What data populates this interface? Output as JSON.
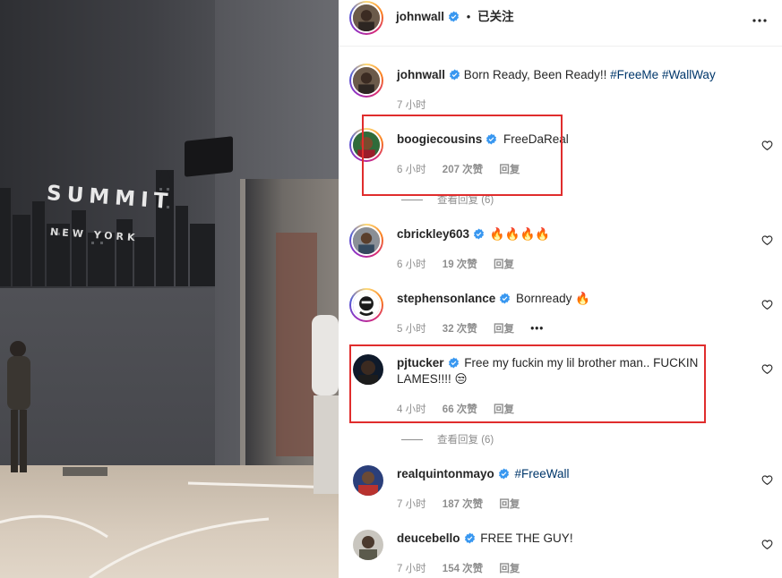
{
  "post": {
    "author": "johnwall",
    "follow_status": "已关注",
    "separator": "•",
    "icons": {
      "verified": "verified-badge-icon",
      "more": "more-options-icon",
      "like": "heart-icon"
    },
    "caption": {
      "username": "johnwall",
      "text": "Born Ready, Been Ready!!",
      "hashtags": [
        "#FreeMe",
        "#WallWay"
      ],
      "time": "7 小时"
    }
  },
  "media": {
    "sign_text": "SUMMIT",
    "sign_subtext": "NEW YORK"
  },
  "comments": [
    {
      "username": "boogiecousins",
      "text": "FreeDaReal",
      "time": "6 小时",
      "likes": "207 次赞",
      "reply": "回复",
      "view_replies": "查看回复 (6)"
    },
    {
      "username": "cbrickley603",
      "text": "🔥🔥🔥🔥",
      "time": "6 小时",
      "likes": "19 次赞",
      "reply": "回复"
    },
    {
      "username": "stephensonlance",
      "text": "Bornready 🔥",
      "time": "5 小时",
      "likes": "32 次赞",
      "reply": "回复",
      "more": "•••"
    },
    {
      "username": "pjtucker",
      "text": "Free my fuckin my lil brother man.. FUCKIN LAMES!!!! 😒",
      "time": "4 小时",
      "likes": "66 次赞",
      "reply": "回复",
      "view_replies": "查看回复 (6)"
    },
    {
      "username": "realquintonmayo",
      "text": "#FreeWall",
      "time": "7 小时",
      "likes": "187 次赞",
      "reply": "回复"
    },
    {
      "username": "deucebello",
      "text": "FREE THE GUY!",
      "time": "7 小时",
      "likes": "154 次赞",
      "reply": "回复"
    }
  ],
  "colors": {
    "highlight": "#e02d2d",
    "verified": "#3897f0",
    "hashtag": "#00376b",
    "muted": "#8e8e8e"
  }
}
